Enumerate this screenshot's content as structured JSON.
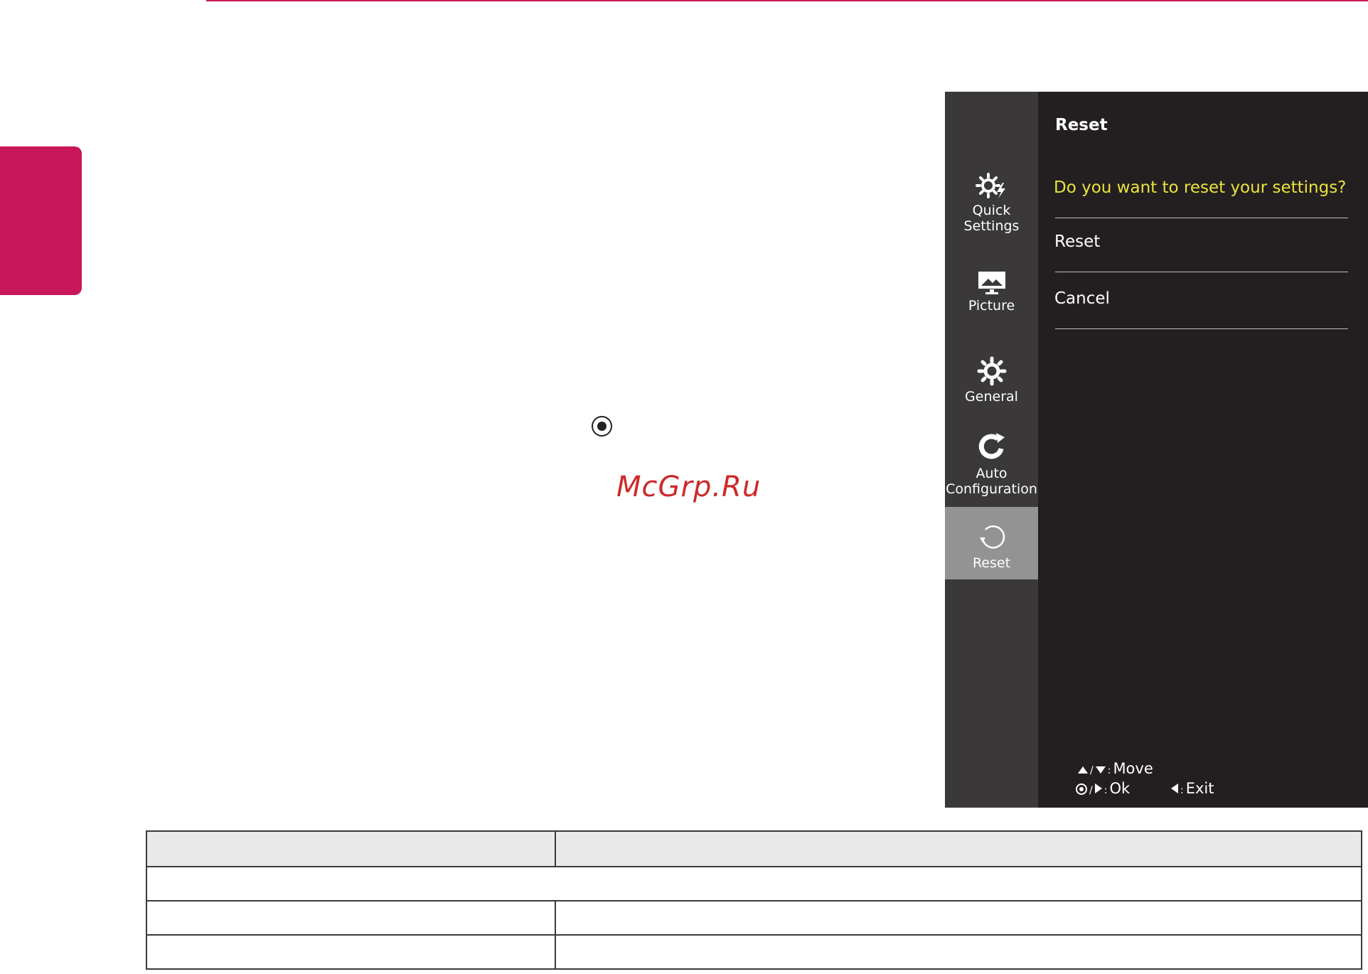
{
  "watermark": "McGrp.Ru",
  "osd": {
    "nav": [
      {
        "label_line1": "Quick",
        "label_line2": "Settings",
        "icon": "quick-settings-icon",
        "active": false
      },
      {
        "label_line1": "Picture",
        "label_line2": "",
        "icon": "picture-icon",
        "active": false
      },
      {
        "label_line1": "General",
        "label_line2": "",
        "icon": "gear-icon",
        "active": false
      },
      {
        "label_line1": "Auto",
        "label_line2": "Configuration",
        "icon": "auto-config-icon",
        "active": false
      },
      {
        "label_line1": "Reset",
        "label_line2": "",
        "icon": "reset-icon",
        "active": true
      }
    ],
    "title": "Reset",
    "question": "Do you want to reset your settings?",
    "options": [
      "Reset",
      "Cancel"
    ],
    "help": {
      "move_sep": "/",
      "move_colon": ":",
      "move_label": "Move",
      "ok_sep": "/",
      "ok_colon": ":",
      "ok_label": "Ok",
      "exit_colon": ":",
      "exit_label": "Exit"
    }
  },
  "colors": {
    "accent": "#c8175a",
    "osd_bg": "#231f20",
    "osd_nav_bg": "#3a3839",
    "osd_active": "#939393",
    "question": "#e8e43c",
    "watermark": "#cc2a2a"
  }
}
